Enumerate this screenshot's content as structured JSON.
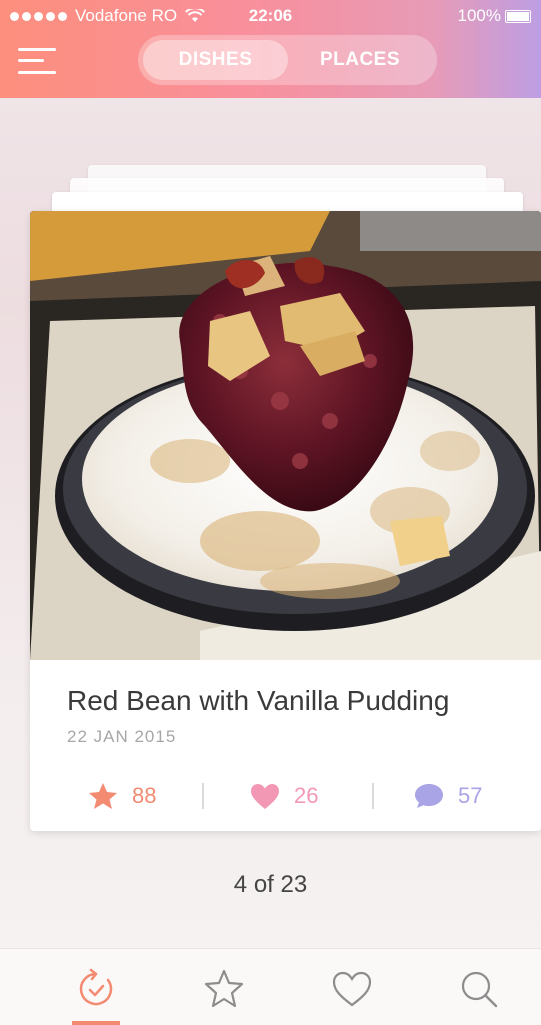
{
  "status_bar": {
    "carrier": "Vodafone RO",
    "time": "22:06",
    "battery": "100%"
  },
  "header": {
    "tabs": [
      {
        "label": "DISHES",
        "selected": true
      },
      {
        "label": "PLACES",
        "selected": false
      }
    ]
  },
  "card": {
    "image": "red bean shaved ice bowl photo",
    "title": "Red Bean with Vanilla Pudding",
    "date": "22 JAN 2015",
    "stats": {
      "likes": "88",
      "hearts": "26",
      "comments": "57"
    }
  },
  "pager": "4 of 23",
  "tabbar": {
    "items": [
      {
        "icon": "refresh-icon",
        "active": true
      },
      {
        "icon": "star-icon",
        "active": false
      },
      {
        "icon": "heart-icon",
        "active": false
      },
      {
        "icon": "search-icon",
        "active": false
      }
    ]
  },
  "colors": {
    "accent_orange": "#f38a72",
    "accent_pink": "#f298b4",
    "accent_purple": "#a8a4e5"
  }
}
